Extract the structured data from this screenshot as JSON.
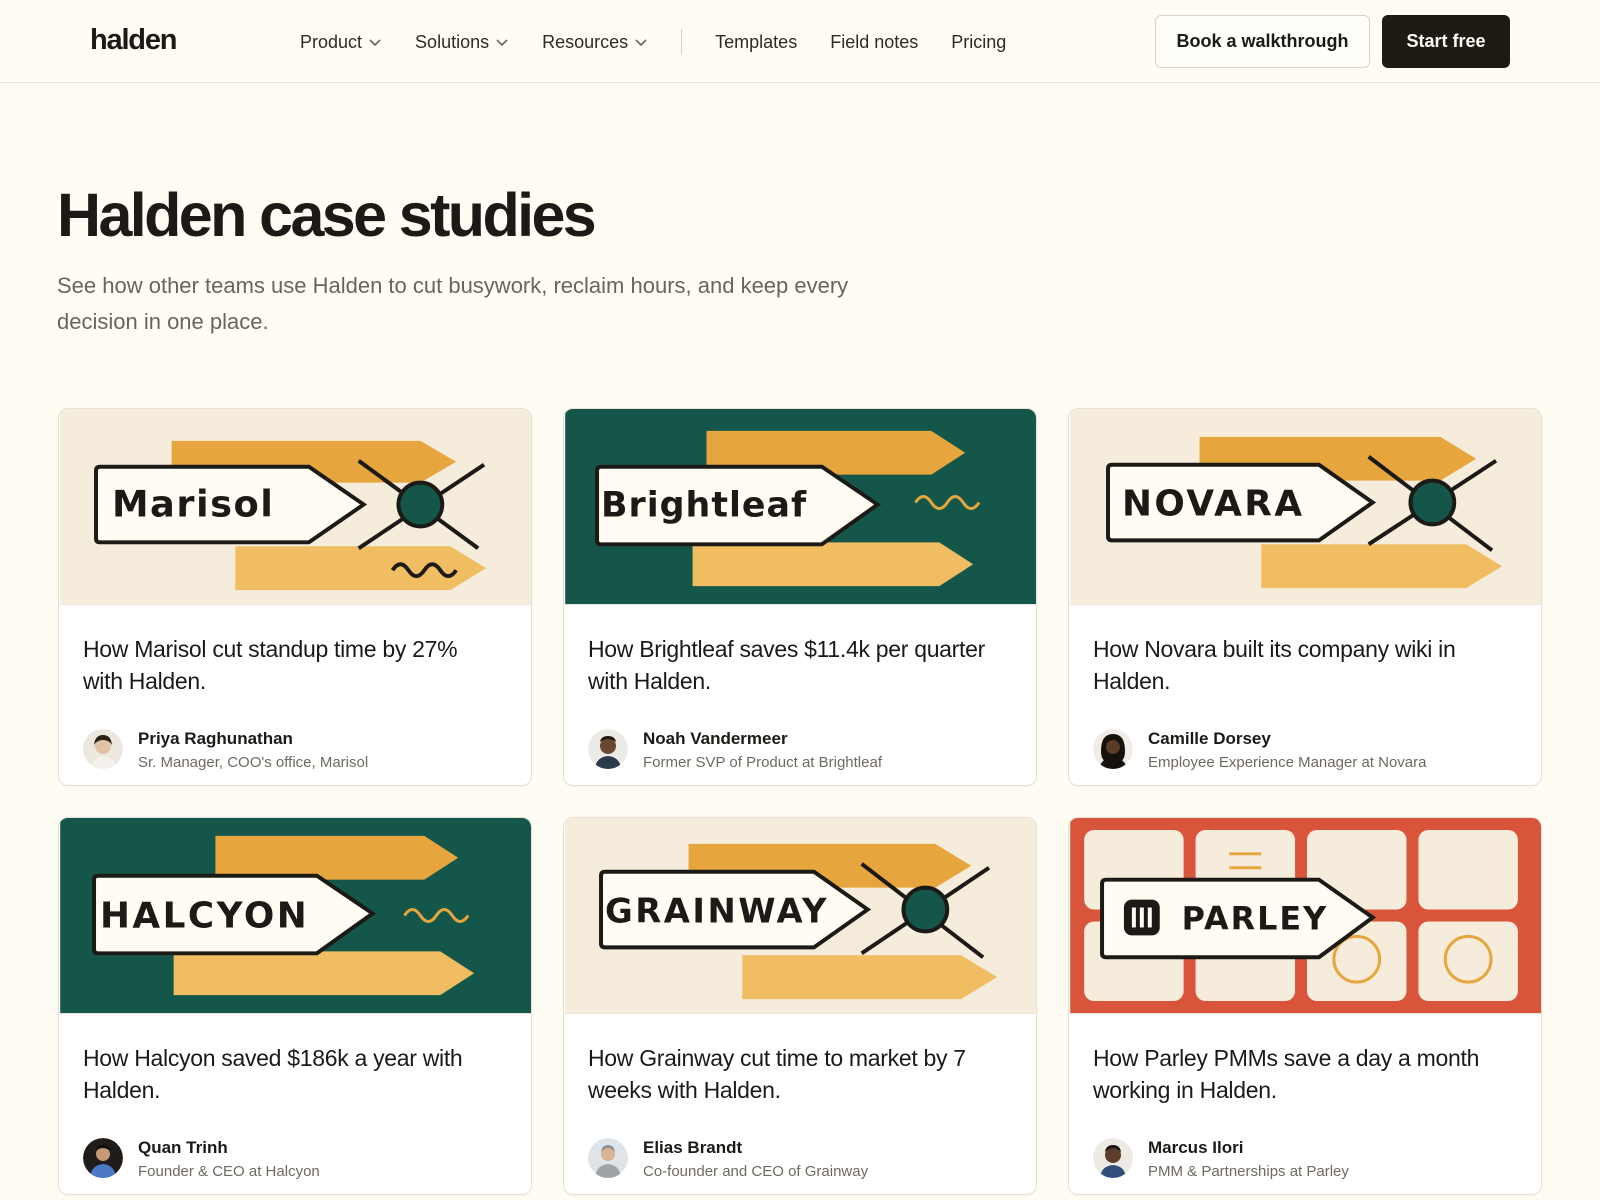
{
  "brand": {
    "logo": "halden"
  },
  "nav": {
    "items": [
      {
        "label": "Product",
        "has_dropdown": true
      },
      {
        "label": "Solutions",
        "has_dropdown": true
      },
      {
        "label": "Resources",
        "has_dropdown": true
      },
      {
        "label": "Templates",
        "has_dropdown": false
      },
      {
        "label": "Field notes",
        "has_dropdown": false
      },
      {
        "label": "Pricing",
        "has_dropdown": false
      }
    ],
    "cta_secondary": "Book a walkthrough",
    "cta_primary": "Start free"
  },
  "hero": {
    "title": "Halden case studies",
    "subtitle": "See how other teams use Halden to cut busywork, reclaim hours, and keep every decision in one place."
  },
  "colors": {
    "background": "#fffcf3",
    "green": "#14574a",
    "mustard": "#e6a63d",
    "mustard_light": "#f0bd62",
    "cream": "#f6ecdc",
    "red": "#d8553c",
    "ink": "#1c1a16"
  },
  "cards": [
    {
      "company": "Marisol",
      "headline": "How Marisol cut standup time by 27% with Halden.",
      "person": "Priya Raghunathan",
      "role": "Sr. Manager, COO's office, Marisol"
    },
    {
      "company": "Brightleaf",
      "headline": "How Brightleaf saves $11.4k per quarter with Halden.",
      "person": "Noah Vandermeer",
      "role": "Former SVP of Product at Brightleaf"
    },
    {
      "company": "NOVARA",
      "headline": "How Novara built its company wiki in Halden.",
      "person": "Camille Dorsey",
      "role": "Employee Experience Manager at Novara"
    },
    {
      "company": "HALCYON",
      "headline": "How Halcyon saved $186k a year with Halden.",
      "person": "Quan Trinh",
      "role": "Founder & CEO at Halcyon"
    },
    {
      "company": "GRAINWAY",
      "headline": "How Grainway cut time to market by 7 weeks with Halden.",
      "person": "Elias Brandt",
      "role": "Co-founder and CEO of Grainway"
    },
    {
      "company": "PARLEY",
      "headline": "How Parley PMMs save a day a month working in Halden.",
      "person": "Marcus Ilori",
      "role": "PMM & Partnerships at Parley"
    }
  ]
}
